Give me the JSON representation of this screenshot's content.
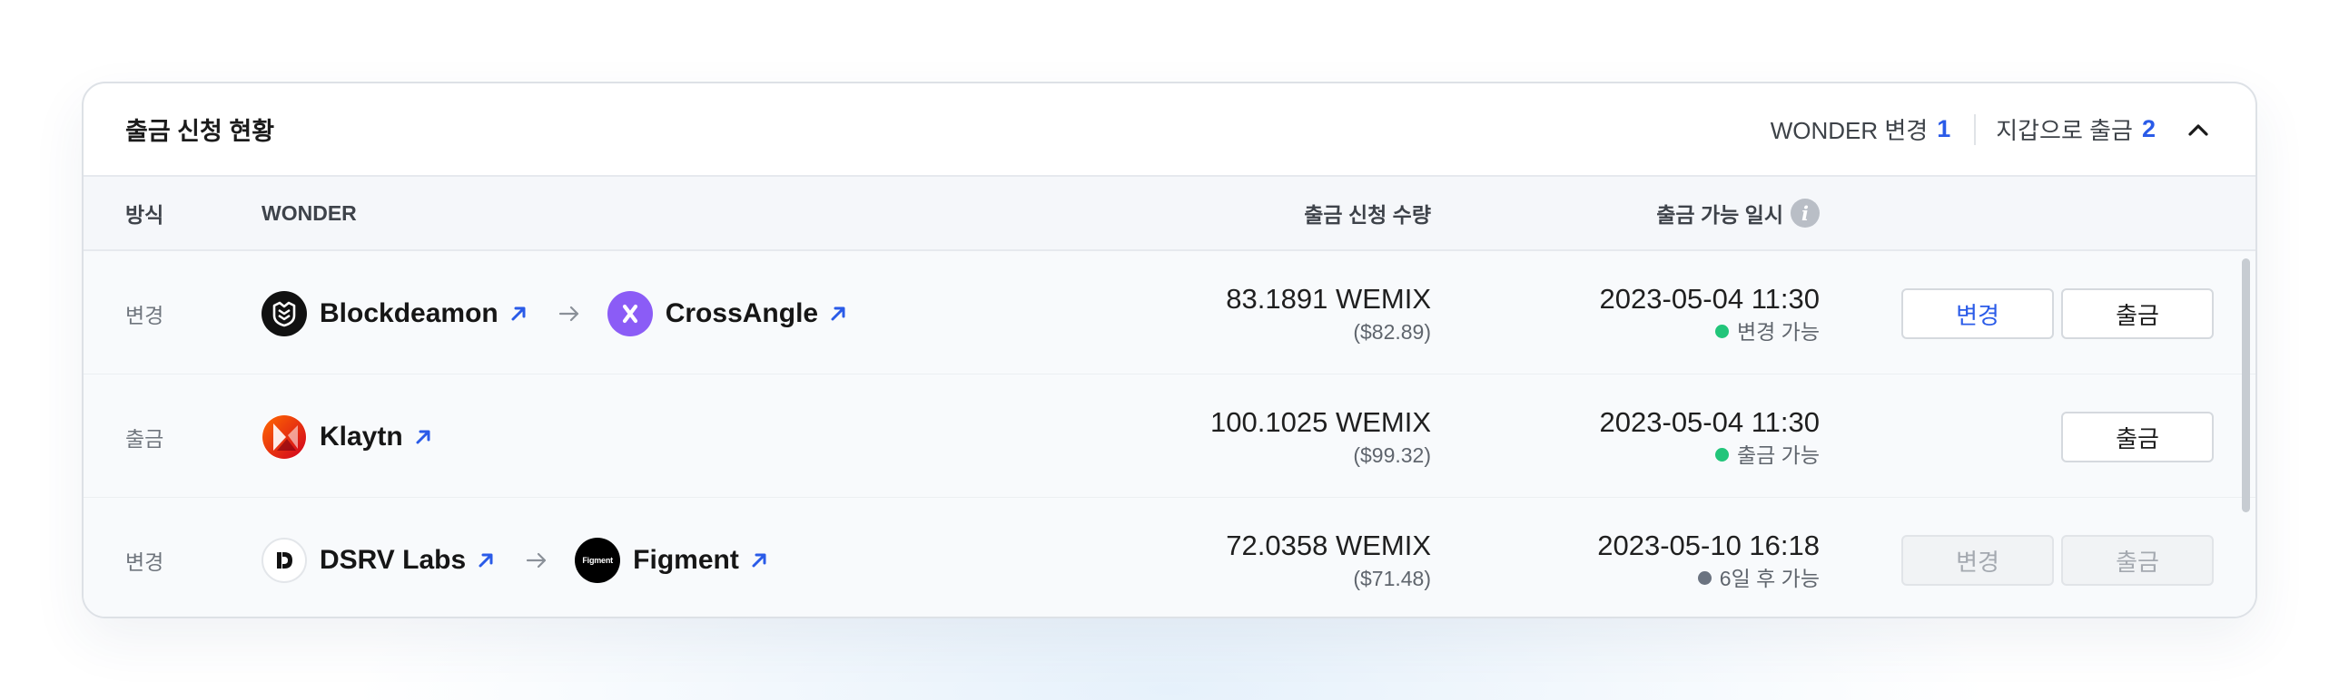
{
  "panel": {
    "title": "출금 신청 현황",
    "summary": [
      {
        "label": "WONDER 변경",
        "count": "1"
      },
      {
        "label": "지갑으로 출금",
        "count": "2"
      }
    ]
  },
  "columns": {
    "method": "방식",
    "wonder": "WONDER",
    "amount": "출금 신청 수량",
    "available_date": "출금 가능 일시"
  },
  "rows": [
    {
      "method": "변경",
      "from": {
        "name": "Blockdeamon",
        "logo": "blockdaemon-logo"
      },
      "to": {
        "name": "CrossAngle",
        "logo": "crossangle-logo"
      },
      "amount": "83.1891 WEMIX",
      "usd": "($82.89)",
      "date": "2023-05-04 11:30",
      "status": "변경 가능",
      "status_color": "#22c57a",
      "buttons": [
        {
          "label": "변경",
          "enabled": true
        },
        {
          "label": "출금",
          "enabled": true
        }
      ]
    },
    {
      "method": "출금",
      "from": {
        "name": "Klaytn",
        "logo": "klaytn-logo"
      },
      "amount": "100.1025 WEMIX",
      "usd": "($99.32)",
      "date": "2023-05-04 11:30",
      "status": "출금 가능",
      "status_color": "#22c57a",
      "buttons": [
        {
          "label": "출금",
          "enabled": true
        }
      ]
    },
    {
      "method": "변경",
      "from": {
        "name": "DSRV Labs",
        "logo": "dsrv-logo"
      },
      "to": {
        "name": "Figment",
        "logo": "figment-logo",
        "logo_text": "Figment"
      },
      "amount": "72.0358 WEMIX",
      "usd": "($71.48)",
      "date": "2023-05-10 16:18",
      "status": "6일 후 가능",
      "status_color": "#6b7380",
      "buttons": [
        {
          "label": "변경",
          "enabled": false
        },
        {
          "label": "출금",
          "enabled": false
        }
      ]
    }
  ],
  "colors": {
    "accent": "#2a5be8",
    "available": "#22c57a",
    "pending": "#6b7380"
  }
}
